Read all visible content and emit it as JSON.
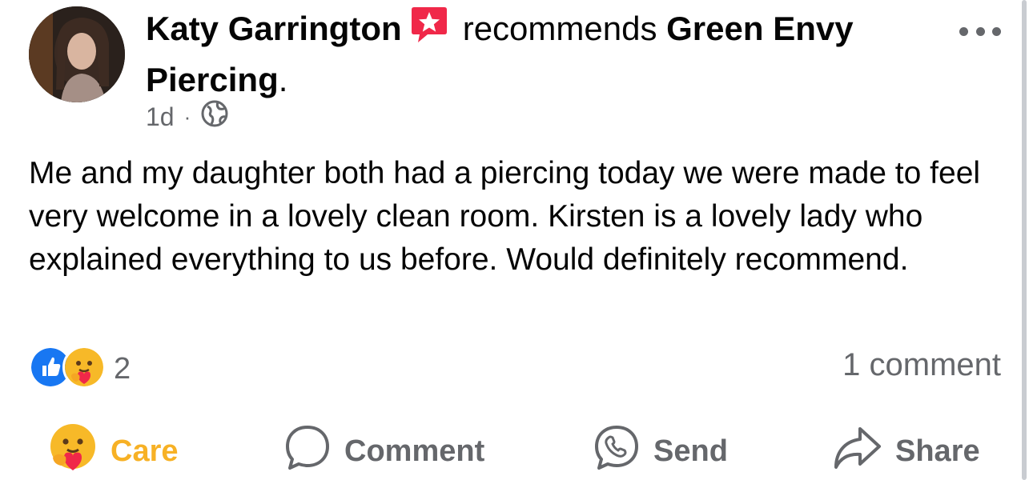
{
  "post": {
    "author": "Katy Garrington",
    "action_text": "recommends",
    "page_name": "Green Envy",
    "page_name_line2": "Piercing",
    "page_name_suffix": ".",
    "timestamp": "1d",
    "separator": "·",
    "privacy_icon": "globe-icon",
    "badge_icon": "recommendation-star-icon",
    "more_icon": "more-options-icon",
    "body": "Me and my daughter both had a piercing today we were made to feel very welcome in a lovely clean room. Kirsten is a lovely lady who explained everything to us before. Would definitely recommend."
  },
  "reactions": {
    "icons": [
      "like-reaction-icon",
      "care-reaction-icon"
    ],
    "count": "2",
    "comment_count": "1 comment"
  },
  "actions": {
    "care_label": "Care",
    "comment_label": "Comment",
    "send_label": "Send",
    "share_label": "Share"
  },
  "colors": {
    "badge": "#f02849",
    "like": "#1877f2",
    "care_label": "#f7b125",
    "secondary_text": "#65676b"
  }
}
